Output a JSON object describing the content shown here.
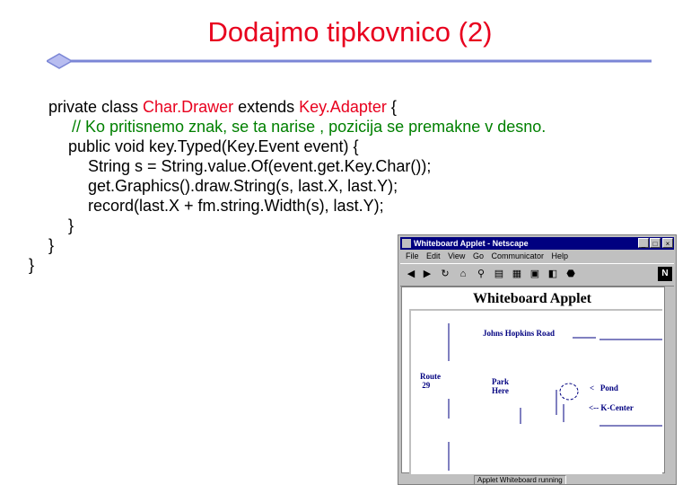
{
  "slide": {
    "title": "Dodajmo tipkovnico (2)",
    "colors": {
      "title": "#e8001e",
      "comment": "#008000",
      "rule": "#7b86d6"
    }
  },
  "code": {
    "line1_prefix": "private class ",
    "line1_class": "Char.Drawer",
    "line1_mid": " extends ",
    "line1_super": "Key.Adapter",
    "line1_suffix": " {",
    "line2": "// Ko pritisnemo znak, se ta narise , pozicija se premakne v desno.",
    "line3": "public void key.Typed(Key.Event event) {",
    "line4": "String s = String.value.Of(event.get.Key.Char());",
    "line5": "get.Graphics().draw.String(s, last.X, last.Y);",
    "line6": "record(last.X + fm.string.Width(s), last.Y);",
    "line7": "}",
    "line8": "}",
    "line9": "}"
  },
  "browser": {
    "window_title": "Whiteboard Applet - Netscape",
    "menu": [
      "File",
      "Edit",
      "View",
      "Go",
      "Communicator",
      "Help"
    ],
    "toolbar_icons": [
      "back-icon",
      "forward-icon",
      "reload-icon",
      "home-icon",
      "search-icon",
      "guide-icon",
      "print-icon",
      "security-icon",
      "shop-icon",
      "stop-icon"
    ],
    "status_text": "Applet Whiteboard running",
    "applet": {
      "title": "Whiteboard Applet",
      "road_label": "Johns Hopkins Road",
      "route_label": "Route\n 29",
      "park_label": "Park\nHere",
      "pond_label": "<   Pond",
      "kcenter_label": "<-- K-Center"
    }
  }
}
